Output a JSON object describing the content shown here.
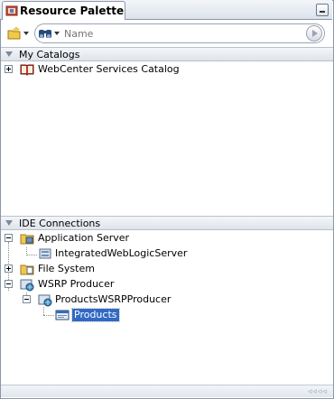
{
  "panel": {
    "title": "Resource Palette",
    "minimize_icon": "minimize-icon"
  },
  "toolbar": {
    "new_icon": "new-folder-icon",
    "search_type_icon": "binoculars-icon",
    "search_placeholder": "Name",
    "search_value": "",
    "go_icon": "play-circle-icon"
  },
  "sections": {
    "my_catalogs": {
      "label": "My Catalogs",
      "items": [
        {
          "label": "WebCenter Services Catalog",
          "icon": "book-catalog-icon",
          "expanded": false
        }
      ]
    },
    "ide_connections": {
      "label": "IDE Connections",
      "items": [
        {
          "label": "Application Server",
          "icon": "server-folder-icon",
          "expanded": true
        },
        {
          "label": "IntegratedWebLogicServer",
          "icon": "server-icon"
        },
        {
          "label": "File System",
          "icon": "file-system-folder-icon",
          "expanded": false
        },
        {
          "label": "WSRP Producer",
          "icon": "wsrp-folder-icon",
          "expanded": true
        },
        {
          "label": "ProductsWSRPProducer",
          "icon": "wsrp-producer-icon",
          "expanded": true
        },
        {
          "label": "Products",
          "icon": "portlet-icon",
          "selected": true
        }
      ]
    }
  },
  "status_bar": {
    "grip": "◃◃◃◃"
  },
  "colors": {
    "selection": "#316ac5",
    "header_border": "#b7c0cc",
    "frame_border": "#8b97a8"
  }
}
